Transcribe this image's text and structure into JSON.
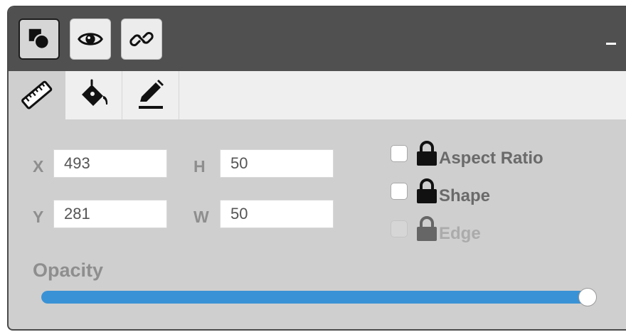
{
  "titlebar": {
    "buttons": [
      {
        "icon": "shapes-icon",
        "active": true
      },
      {
        "icon": "eye-icon",
        "active": false
      },
      {
        "icon": "link-icon",
        "active": false
      }
    ],
    "minimize_icon": "minimize-icon"
  },
  "tabs": [
    {
      "icon": "ruler-icon",
      "active": true
    },
    {
      "icon": "paint-bucket-icon",
      "active": false
    },
    {
      "icon": "pen-icon",
      "active": false
    }
  ],
  "geometry": {
    "x": {
      "label": "X",
      "value": "493"
    },
    "y": {
      "label": "Y",
      "value": "281"
    },
    "h": {
      "label": "H",
      "value": "50"
    },
    "w": {
      "label": "W",
      "value": "50"
    }
  },
  "locks": [
    {
      "label": "Aspect Ratio",
      "checked": false,
      "disabled": false
    },
    {
      "label": "Shape",
      "checked": false,
      "disabled": false
    },
    {
      "label": "Edge",
      "checked": false,
      "disabled": true
    }
  ],
  "opacity": {
    "label": "Opacity",
    "value": 1.0
  },
  "colors": {
    "titlebar": "#505050",
    "panel": "#cfcfcf",
    "tabbar": "#efefef",
    "accent": "#3a92d6"
  }
}
